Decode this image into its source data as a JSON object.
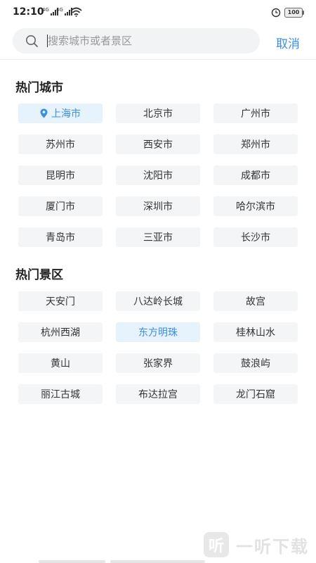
{
  "status_bar": {
    "time": "12:10",
    "signal_1_label": "4G",
    "signal_2_label": "4G",
    "battery": "100"
  },
  "search": {
    "placeholder": "搜索城市或者景区",
    "value": "",
    "cancel_label": "取消"
  },
  "hot_cities": {
    "title": "热门城市",
    "items": [
      {
        "label": "上海市",
        "selected": true,
        "icon": "location-pin-icon"
      },
      {
        "label": "北京市"
      },
      {
        "label": "广州市"
      },
      {
        "label": "苏州市"
      },
      {
        "label": "西安市"
      },
      {
        "label": "郑州市"
      },
      {
        "label": "昆明市"
      },
      {
        "label": "沈阳市"
      },
      {
        "label": "成都市"
      },
      {
        "label": "厦门市"
      },
      {
        "label": "深圳市"
      },
      {
        "label": "哈尔滨市"
      },
      {
        "label": "青岛市"
      },
      {
        "label": "三亚市"
      },
      {
        "label": "长沙市"
      }
    ]
  },
  "hot_scenic": {
    "title": "热门景区",
    "items": [
      {
        "label": "天安门"
      },
      {
        "label": "八达岭长城"
      },
      {
        "label": "故宫"
      },
      {
        "label": "杭州西湖"
      },
      {
        "label": "东方明珠",
        "selected": true
      },
      {
        "label": "桂林山水"
      },
      {
        "label": "黄山"
      },
      {
        "label": "张家界"
      },
      {
        "label": "鼓浪屿"
      },
      {
        "label": "丽江古城"
      },
      {
        "label": "布达拉宫"
      },
      {
        "label": "龙门石窟"
      }
    ]
  },
  "watermark": {
    "icon_text": "听",
    "text": "一听下载"
  },
  "colors": {
    "accent": "#3a8ee6",
    "chip_bg": "#f4f5f7",
    "chip_selected_bg": "#e6f3fd",
    "search_bg": "#f2f3f5"
  }
}
